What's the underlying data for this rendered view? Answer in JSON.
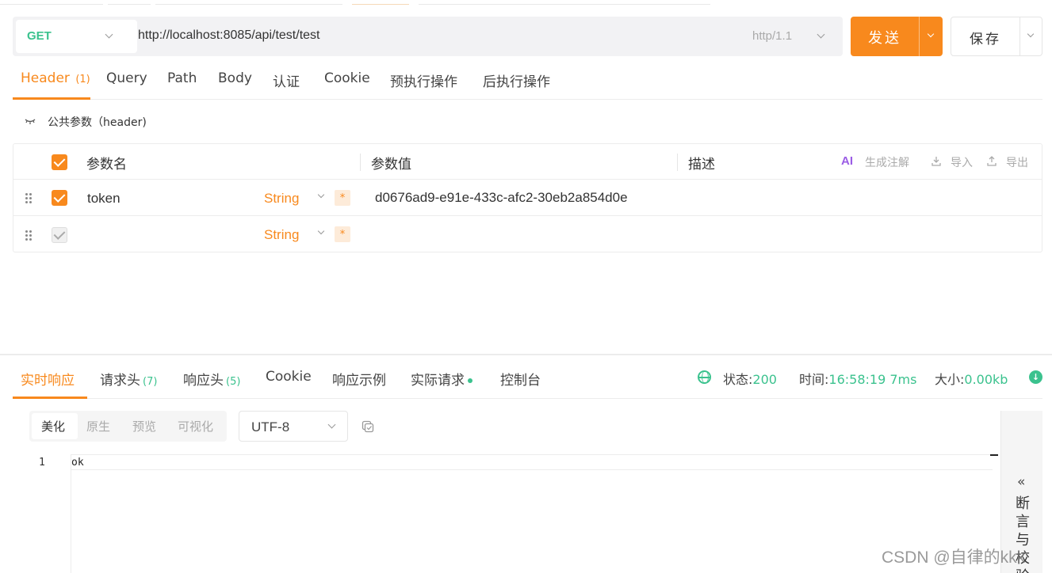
{
  "request": {
    "method": "GET",
    "url": "http://localhost:8085/api/test/test",
    "http_version": "http/1.1",
    "send_label": "发送",
    "save_label": "保存"
  },
  "request_tabs": [
    {
      "label": "Header",
      "count": "(1)"
    },
    {
      "label": "Query"
    },
    {
      "label": "Path"
    },
    {
      "label": "Body"
    },
    {
      "label": "认证"
    },
    {
      "label": "Cookie"
    },
    {
      "label": "预执行操作"
    },
    {
      "label": "后执行操作"
    }
  ],
  "public_params_label": "公共参数（header)",
  "params_table": {
    "headers": {
      "name": "参数名",
      "value": "参数值",
      "description": "描述"
    },
    "tools": {
      "ai_badge": "AI",
      "generate_comment": "生成注解",
      "import": "导入",
      "export": "导出"
    },
    "rows": [
      {
        "checked": true,
        "name": "token",
        "type": "String",
        "required": "*",
        "value": "d0676ad9-e91e-433c-afc2-30eb2a854d0e"
      },
      {
        "checked": false,
        "name": "",
        "type": "String",
        "required": "*",
        "value": ""
      }
    ]
  },
  "response_tabs": [
    {
      "label": "实时响应"
    },
    {
      "label": "请求头",
      "count": "(7)"
    },
    {
      "label": "响应头",
      "count": "(5)"
    },
    {
      "label": "Cookie"
    },
    {
      "label": "响应示例"
    },
    {
      "label": "实际请求"
    },
    {
      "label": "控制台"
    }
  ],
  "status": {
    "status_label": "状态:",
    "status_value": "200",
    "time_label": "时间:",
    "time_value": "16:58:19",
    "duration": "7ms",
    "size_label": "大小:",
    "size_value": "0.00kb"
  },
  "view_modes": [
    "美化",
    "原生",
    "预览",
    "可视化"
  ],
  "encoding": "UTF-8",
  "response_body": {
    "line_number": "1",
    "content": "ok"
  },
  "side_panel": {
    "arrow": "«",
    "label": "断言与校验"
  },
  "watermark": "CSDN @自律的kkk",
  "colors": {
    "accent": "#f8891d",
    "success": "#3bc28e"
  }
}
